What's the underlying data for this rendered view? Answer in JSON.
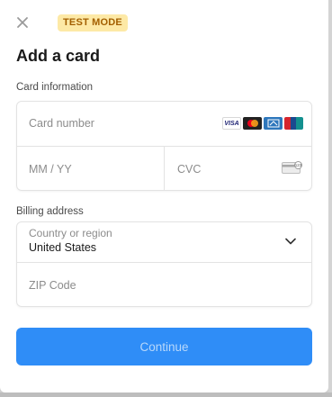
{
  "header": {
    "close_icon": "close-icon",
    "badge": "TEST MODE",
    "badge_bg": "#fde9a6",
    "badge_fg": "#a35f00"
  },
  "title": "Add a card",
  "card_section": {
    "label": "Card information",
    "card_number_placeholder": "Card number",
    "expiry_placeholder": "MM / YY",
    "cvc_placeholder": "CVC",
    "brand_icons": [
      "visa-icon",
      "mastercard-icon",
      "amex-icon",
      "unionpay-icon"
    ],
    "visa_text": "VISA",
    "cvc_icon": "cvc-card-icon"
  },
  "billing_section": {
    "label": "Billing address",
    "country_label": "Country or region",
    "country_value": "United States",
    "zip_placeholder": "ZIP Code"
  },
  "continue_label": "Continue",
  "accent": "#2f8df7"
}
